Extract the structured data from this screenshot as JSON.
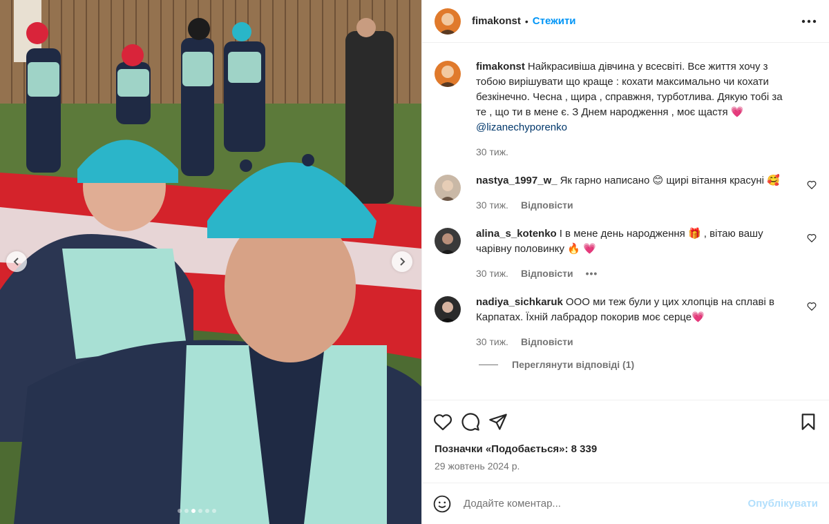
{
  "post": {
    "username": "fimakonst",
    "separator": "•",
    "follow_label": "Стежити",
    "more_icon": "more-horizontal-icon"
  },
  "caption": {
    "username": "fimakonst",
    "text": "Найкрасивіша дівчина у всесвіті. Все життя хочу з тобою вирішувати що краще : кохати максимально чи кохати безкінечно. Чесна , щира , справжня, турботлива. Дякую тобі за те , що ти в мене є. З Днем народження , моє щастя ",
    "emoji": "💗",
    "mention": "@lizanechyporenko",
    "time": "30 тиж."
  },
  "comments": [
    {
      "username": "nastya_1997_w_",
      "text": "Як гарно написано 😊 щирі вітання красуні 🥰",
      "time": "30 тиж.",
      "reply_label": "Відповісти",
      "avatar_color": "#c9b8a6"
    },
    {
      "username": "alina_s_kotenko",
      "text": "І в мене день народження 🎁 , вітаю вашу чарівну половинку 🔥 💗",
      "time": "30 тиж.",
      "reply_label": "Відповісти",
      "more": "•••",
      "avatar_color": "#3a3a3a"
    },
    {
      "username": "nadiya_sichkaruk",
      "text": "ООО ми теж були у цих хлопців на сплаві в Карпатах. Їхній лабрадор покорив моє серце💗",
      "time": "30 тиж.",
      "reply_label": "Відповісти",
      "avatar_color": "#2b2b2b"
    }
  ],
  "view_replies": "Переглянути відповіді (1)",
  "likes": "Позначки «Подобається»: 8 339",
  "date": "29 жовтень 2024 р.",
  "add_comment": {
    "placeholder": "Додайте коментар...",
    "publish_label": "Опублікувати"
  },
  "colors": {
    "link": "#0095f6",
    "mention": "#00376b",
    "muted": "#737373",
    "publish_disabled": "#b2dffc"
  },
  "carousel": {
    "total_dots": 6,
    "active_dot": 2
  }
}
